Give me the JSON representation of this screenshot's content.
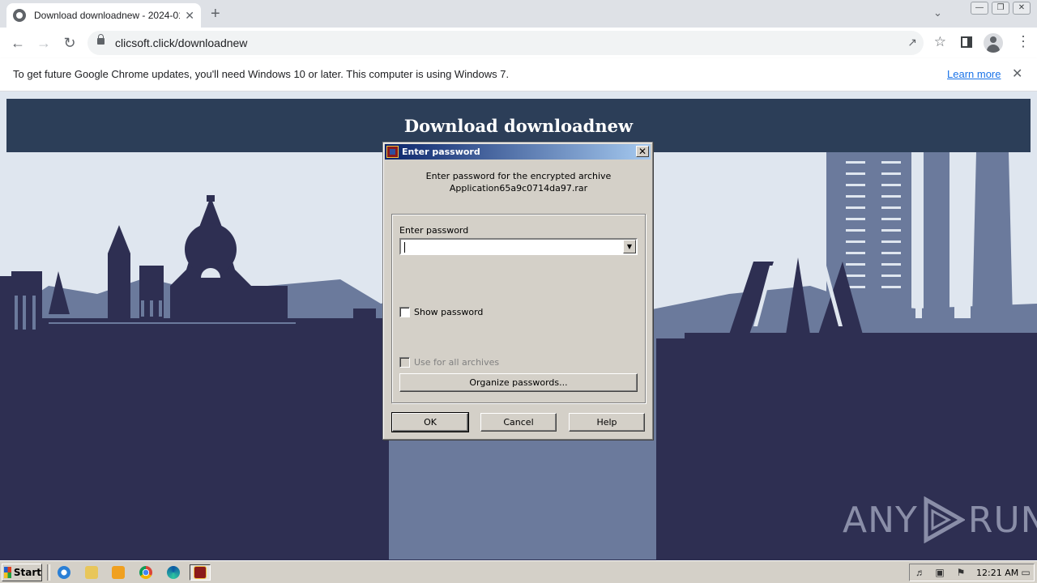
{
  "browser": {
    "tab_title": "Download downloadnew - 2024-01-",
    "tab_close": "✕",
    "new_tab": "+",
    "url": "clicsoft.click/downloadnew",
    "infobar": {
      "message": "To get future Google Chrome updates, you'll need Windows 10 or later. This computer is using Windows 7.",
      "link": "Learn more"
    }
  },
  "page": {
    "heading": "Download downloadnew",
    "watermark_left": "ANY",
    "watermark_right": "RUN"
  },
  "dialog": {
    "title": "Enter password",
    "desc_line1": "Enter password for the encrypted archive",
    "desc_line2": "Application65a9c0714da97.rar",
    "field_label": "Enter password",
    "password_value": "",
    "show_password": "Show password",
    "use_for_all": "Use for all archives",
    "organize": "Organize passwords...",
    "ok": "OK",
    "cancel": "Cancel",
    "help": "Help"
  },
  "taskbar": {
    "start": "Start",
    "clock": "12:21 AM"
  },
  "colors": {
    "page_header_bg": "#2c3e58",
    "skyline_dark": "#2e2f52",
    "skyline_mid": "#6b7a9c",
    "sky": "#dfe6ef",
    "titlebar_start": "#0a246a",
    "titlebar_end": "#a6caf0"
  }
}
